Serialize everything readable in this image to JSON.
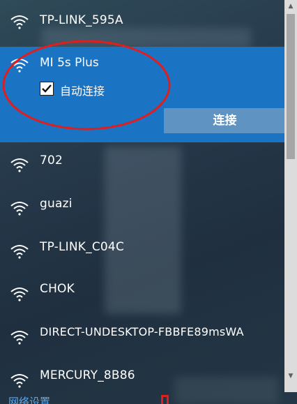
{
  "networks_top": [
    {
      "ssid": "TP-LINK_595A"
    }
  ],
  "selected_network": {
    "ssid": "MI 5s Plus",
    "auto_connect_label": "自动连接",
    "auto_connect_checked": true,
    "connect_label": "连接"
  },
  "networks": [
    {
      "ssid": "702"
    },
    {
      "ssid": "guazi"
    },
    {
      "ssid": "TP-LINK_C04C"
    },
    {
      "ssid": "CHOK"
    },
    {
      "ssid": "DIRECT-UNDESKTOP-FBBFE89msWA"
    },
    {
      "ssid": "MERCURY_8B86"
    }
  ],
  "footer": {
    "network_settings_label": "网络设置"
  },
  "colors": {
    "accent": "#1b73c4",
    "connect_button": "#5f93c2",
    "annotation": "#e01e1e",
    "link": "#5aa7ee"
  },
  "icons": {
    "network": "wifi-icon",
    "check": "checkmark-icon",
    "scroll_up": "chevron-up-icon",
    "scroll_down": "chevron-down-icon"
  }
}
